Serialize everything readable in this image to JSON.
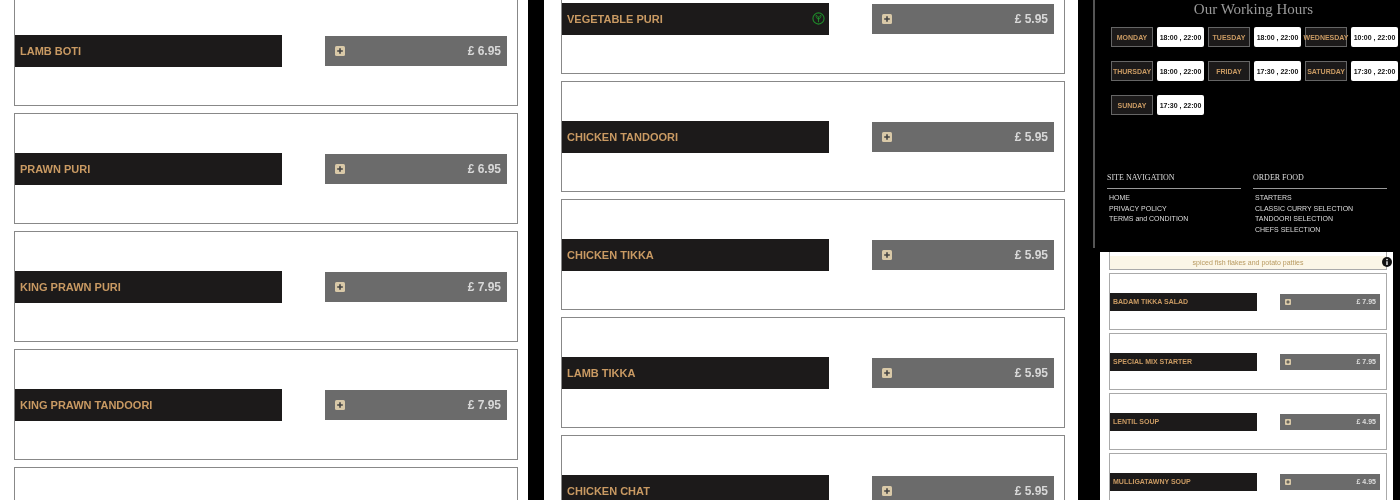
{
  "menu_panels": [
    {
      "items": [
        {
          "name": "LAMB BOTI",
          "price": "£ 6.95",
          "vegetarian": false
        },
        {
          "name": "PRAWN PURI",
          "price": "£ 6.95",
          "vegetarian": false
        },
        {
          "name": "KING PRAWN PURI",
          "price": "£ 7.95",
          "vegetarian": false
        },
        {
          "name": "KING PRAWN TANDOORI",
          "price": "£ 7.95",
          "vegetarian": false
        }
      ]
    },
    {
      "items": [
        {
          "name": "VEGETABLE PURI",
          "price": "£ 5.95",
          "vegetarian": true
        },
        {
          "name": "CHICKEN TANDOORI",
          "price": "£ 5.95",
          "vegetarian": false
        },
        {
          "name": "CHICKEN TIKKA",
          "price": "£ 5.95",
          "vegetarian": false
        },
        {
          "name": "LAMB TIKKA",
          "price": "£ 5.95",
          "vegetarian": false
        },
        {
          "name": "CHICKEN CHAT",
          "price": "£ 5.95",
          "vegetarian": false
        }
      ]
    }
  ],
  "footer": {
    "title": "Our Working Hours",
    "hours": [
      {
        "day": "MONDAY",
        "time": "18:00 , 22:00"
      },
      {
        "day": "TUESDAY",
        "time": "18:00 , 22:00"
      },
      {
        "day": "WEDNESDAY",
        "time": "10:00 , 22:00"
      },
      {
        "day": "THURSDAY",
        "time": "18:00 , 22:00"
      },
      {
        "day": "FRIDAY",
        "time": "17:30 , 22:00"
      },
      {
        "day": "SATURDAY",
        "time": "17:30 , 22:00"
      },
      {
        "day": "SUNDAY",
        "time": "17:30 , 22:00"
      }
    ],
    "nav_columns": [
      {
        "heading": "SITE NAVIGATION",
        "links": [
          "HOME",
          "PRIVACY POLICY",
          "TERMS and CONDITION"
        ]
      },
      {
        "heading": "ORDER FOOD",
        "links": [
          "STARTERS",
          "CLASSIC CURRY SELECTION",
          "TANDOORI SELECTION",
          "CHEFS SELECTION"
        ]
      }
    ]
  },
  "mini_menu": {
    "description": "spiced fish flakes and potato patties",
    "items": [
      {
        "name": "BADAM TIKKA SALAD",
        "price": "£ 7.95"
      },
      {
        "name": "SPECIAL MIX STARTER",
        "price": "£ 7.95"
      },
      {
        "name": "LENTIL SOUP",
        "price": "£ 4.95"
      },
      {
        "name": "MULLIGATAWNY SOUP",
        "price": "£ 4.95"
      }
    ]
  }
}
